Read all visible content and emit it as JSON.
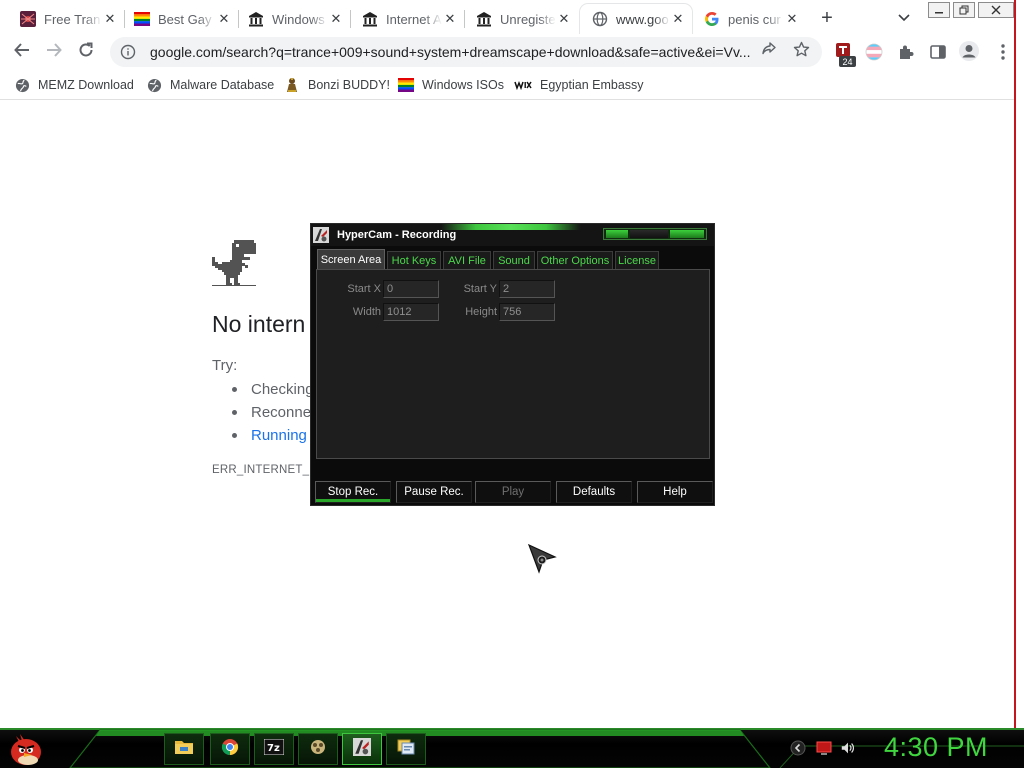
{
  "browser": {
    "tabs": [
      {
        "title": "Free Tran",
        "favicon": "spider-favicon",
        "active": false
      },
      {
        "title": "Best Gay",
        "favicon": "rainbow-flag-favicon",
        "active": false
      },
      {
        "title": "Windows",
        "favicon": "archive-building-favicon",
        "active": false
      },
      {
        "title": "Internet A",
        "favicon": "archive-building-favicon",
        "active": false
      },
      {
        "title": "Unregiste",
        "favicon": "archive-building-favicon",
        "active": false
      },
      {
        "title": "www.goo",
        "favicon": "globe-favicon",
        "active": true
      },
      {
        "title": "penis cur",
        "favicon": "google-favicon",
        "active": false
      }
    ],
    "new_tab": "+",
    "tab_list": "⌄",
    "url": "google.com/search?q=trance+009+sound+system+dreamscape+download&safe=active&ei=Vv...",
    "extension_badge": "24",
    "bookmarks": [
      {
        "label": "MEMZ Download",
        "icon": "globe-icon"
      },
      {
        "label": "Malware Database",
        "icon": "globe-icon"
      },
      {
        "label": "Bonzi BUDDY!",
        "icon": "bonzi-icon"
      },
      {
        "label": "Windows ISOs",
        "icon": "rainbow-flag-icon"
      },
      {
        "label": "Egyptian Embassy",
        "icon": "wix-icon"
      }
    ]
  },
  "page": {
    "error_title": "No intern",
    "try_label": "Try:",
    "suggestions": [
      "Checking",
      "Reconne",
      "Running"
    ],
    "error_code": "ERR_INTERNET_DIS"
  },
  "hypercam": {
    "title": "HyperCam - Recording",
    "tabs": [
      "Screen Area",
      "Hot Keys",
      "AVI File",
      "Sound",
      "Other Options",
      "License"
    ],
    "active_tab": "Screen Area",
    "fields": {
      "start_x_label": "Start X",
      "start_x": "0",
      "start_y_label": "Start Y",
      "start_y": "2",
      "width_label": "Width",
      "width": "1012",
      "height_label": "Height",
      "height": "756"
    },
    "buttons": [
      "Stop Rec.",
      "Pause Rec.",
      "Play",
      "Defaults",
      "Help"
    ]
  },
  "taskbar": {
    "clock": "4:30 PM",
    "apps": [
      "folder-icon",
      "chrome-icon",
      "7zip-icon",
      "media-icon",
      "hypercam-icon",
      "files-icon"
    ]
  },
  "colors": {
    "accent_green": "#3fd63f",
    "link_blue": "#1a73e8",
    "window_red": "#c4161c"
  }
}
